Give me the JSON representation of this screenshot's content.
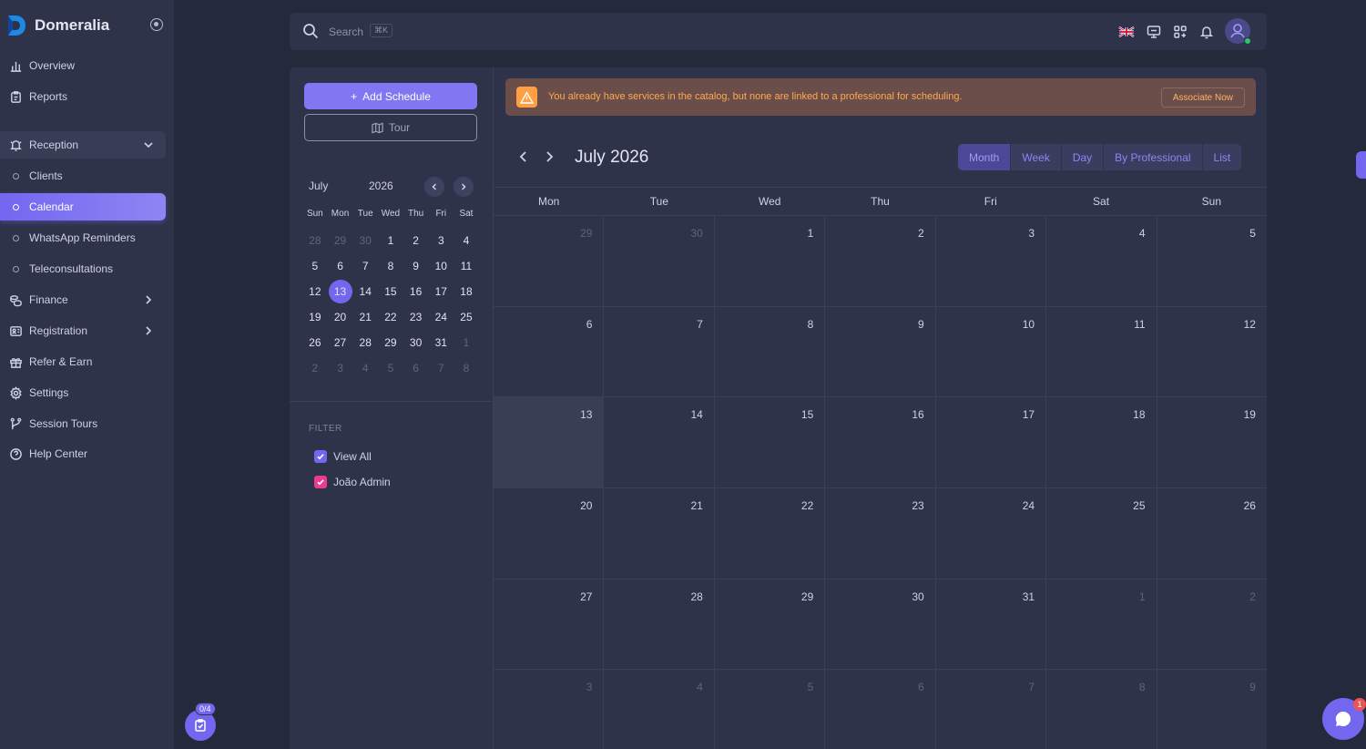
{
  "brand": {
    "name": "Domeralia"
  },
  "sidebar": {
    "items": [
      {
        "label": "Overview"
      },
      {
        "label": "Reports"
      },
      {
        "label": "Reception"
      },
      {
        "label": "Clients"
      },
      {
        "label": "Calendar"
      },
      {
        "label": "WhatsApp Reminders"
      },
      {
        "label": "Teleconsultations"
      },
      {
        "label": "Finance"
      },
      {
        "label": "Registration"
      },
      {
        "label": "Refer & Earn"
      },
      {
        "label": "Settings"
      },
      {
        "label": "Session Tours"
      },
      {
        "label": "Help Center"
      }
    ]
  },
  "progress_badge": {
    "count": "0/4"
  },
  "topbar": {
    "search_label": "Search",
    "shortcut": "⌘K"
  },
  "actions": {
    "add_schedule": "Add Schedule",
    "tour": "Tour"
  },
  "mini_calendar": {
    "month": "July",
    "year": "2026",
    "weekdays": [
      "Sun",
      "Mon",
      "Tue",
      "Wed",
      "Thu",
      "Fri",
      "Sat"
    ],
    "weeks": [
      [
        "28",
        "29",
        "30",
        "1",
        "2",
        "3",
        "4"
      ],
      [
        "5",
        "6",
        "7",
        "8",
        "9",
        "10",
        "11"
      ],
      [
        "12",
        "13",
        "14",
        "15",
        "16",
        "17",
        "18"
      ],
      [
        "19",
        "20",
        "21",
        "22",
        "23",
        "24",
        "25"
      ],
      [
        "26",
        "27",
        "28",
        "29",
        "30",
        "31",
        "1"
      ],
      [
        "2",
        "3",
        "4",
        "5",
        "6",
        "7",
        "8"
      ]
    ]
  },
  "filter": {
    "title": "FILTER",
    "options": [
      {
        "label": "View All",
        "color": "#7367f0"
      },
      {
        "label": "João Admin",
        "color": "#e83e8c"
      }
    ]
  },
  "alert": {
    "message": "You already have services in the catalog, but none are linked to a professional for scheduling.",
    "action": "Associate Now"
  },
  "calendar": {
    "title": "July 2026",
    "views": [
      "Month",
      "Week",
      "Day",
      "By Professional",
      "List"
    ],
    "active_view": "Month",
    "weekdays": [
      "Mon",
      "Tue",
      "Wed",
      "Thu",
      "Fri",
      "Sat",
      "Sun"
    ],
    "weeks": [
      [
        "29",
        "30",
        "1",
        "2",
        "3",
        "4",
        "5"
      ],
      [
        "6",
        "7",
        "8",
        "9",
        "10",
        "11",
        "12"
      ],
      [
        "13",
        "14",
        "15",
        "16",
        "17",
        "18",
        "19"
      ],
      [
        "20",
        "21",
        "22",
        "23",
        "24",
        "25",
        "26"
      ],
      [
        "27",
        "28",
        "29",
        "30",
        "31",
        "1",
        "2"
      ],
      [
        "3",
        "4",
        "5",
        "6",
        "7",
        "8",
        "9"
      ]
    ]
  },
  "chat": {
    "badge": "1"
  },
  "colors": {
    "accent": "#7367f0",
    "warning": "#ff9f43"
  }
}
